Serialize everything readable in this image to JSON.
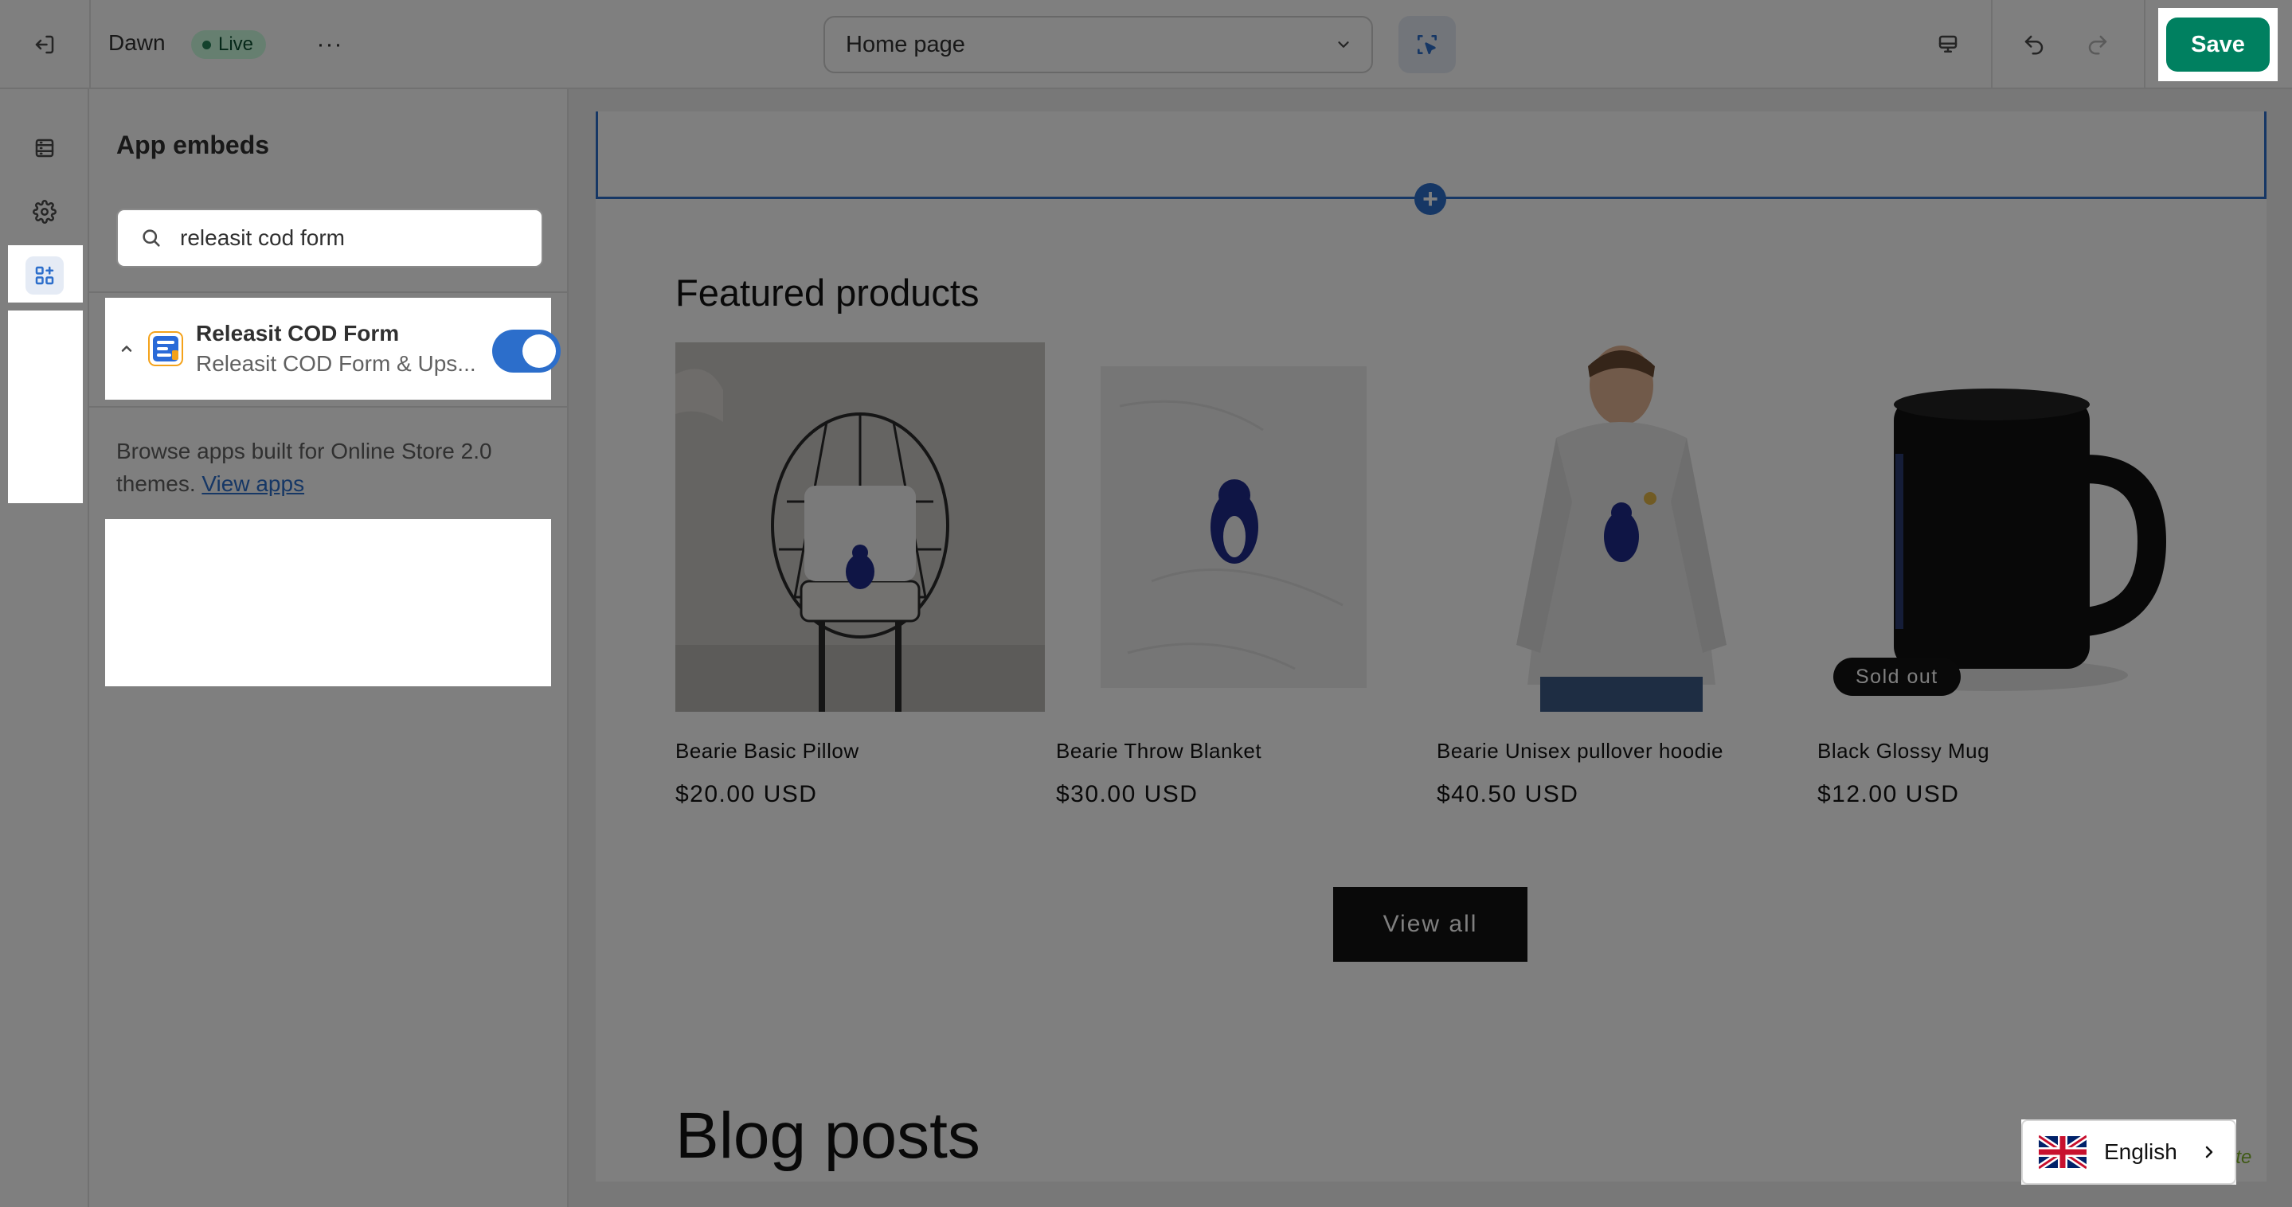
{
  "topbar": {
    "theme_name": "Dawn",
    "status_badge": "Live",
    "more_label": "···",
    "page_selector": {
      "value": "Home page"
    },
    "save_label": "Save"
  },
  "sidebar": {
    "title": "App embeds",
    "search": {
      "value": "releasit cod form"
    },
    "embed": {
      "title": "Releasit COD Form",
      "subtitle": "Releasit COD Form & Ups...",
      "enabled": true
    },
    "browse_text": "Browse apps built for Online Store 2.0 themes.",
    "browse_link": "View apps"
  },
  "preview": {
    "section_title": "Featured products",
    "products": [
      {
        "name": "Bearie Basic Pillow",
        "price": "$20.00 USD"
      },
      {
        "name": "Bearie Throw Blanket",
        "price": "$30.00 USD"
      },
      {
        "name": "Bearie Unisex pullover hoodie",
        "price": "$40.50 USD"
      },
      {
        "name": "Black Glossy Mug",
        "price": "$12.00 USD",
        "badge": "Sold out"
      }
    ],
    "view_all_label": "View all",
    "blog_title": "Blog posts",
    "language": "English"
  },
  "colors": {
    "save": "#008060",
    "accent": "#2c6ecb",
    "live_badge": "#cdfee1",
    "overlay": "rgba(0,0,0,0.5)"
  }
}
